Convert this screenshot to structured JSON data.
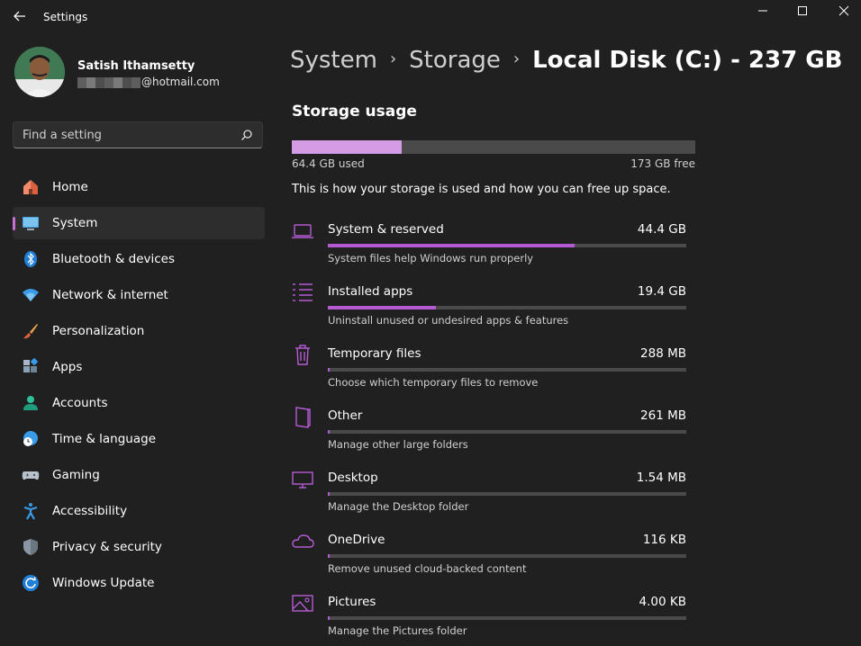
{
  "app": {
    "title": "Settings"
  },
  "user": {
    "name": "Satish Ithamsetty",
    "email_suffix": "@hotmail.com"
  },
  "search": {
    "placeholder": "Find a setting"
  },
  "nav": [
    {
      "label": "Home",
      "icon": "home-icon"
    },
    {
      "label": "System",
      "icon": "system-icon",
      "active": true
    },
    {
      "label": "Bluetooth & devices",
      "icon": "bluetooth-icon"
    },
    {
      "label": "Network & internet",
      "icon": "wifi-icon"
    },
    {
      "label": "Personalization",
      "icon": "brush-icon"
    },
    {
      "label": "Apps",
      "icon": "apps-icon"
    },
    {
      "label": "Accounts",
      "icon": "accounts-icon"
    },
    {
      "label": "Time & language",
      "icon": "globe-clock-icon"
    },
    {
      "label": "Gaming",
      "icon": "gamepad-icon"
    },
    {
      "label": "Accessibility",
      "icon": "accessibility-icon"
    },
    {
      "label": "Privacy & security",
      "icon": "shield-icon"
    },
    {
      "label": "Windows Update",
      "icon": "update-icon"
    }
  ],
  "breadcrumb": {
    "level1": "System",
    "level2": "Storage",
    "current": "Local Disk (C:) - 237 GB"
  },
  "storage": {
    "title": "Storage usage",
    "used_label": "64.4 GB used",
    "free_label": "173 GB free",
    "used_fraction": 0.272,
    "description": "This is how your storage is used and how you can free up space."
  },
  "categories": [
    {
      "name": "System & reserved",
      "size": "44.4 GB",
      "subtitle": "System files help Windows run properly",
      "fraction": 0.689,
      "icon": "laptop-icon"
    },
    {
      "name": "Installed apps",
      "size": "19.4 GB",
      "subtitle": "Uninstall unused or undesired apps & features",
      "fraction": 0.301,
      "icon": "list-icon"
    },
    {
      "name": "Temporary files",
      "size": "288 MB",
      "subtitle": "Choose which temporary files to remove",
      "fraction": 0.005,
      "icon": "trash-icon"
    },
    {
      "name": "Other",
      "size": "261 MB",
      "subtitle": "Manage other large folders",
      "fraction": 0.004,
      "icon": "folder-icon"
    },
    {
      "name": "Desktop",
      "size": "1.54 MB",
      "subtitle": "Manage the Desktop folder",
      "fraction": 0.001,
      "icon": "monitor-icon"
    },
    {
      "name": "OneDrive",
      "size": "116 KB",
      "subtitle": "Remove unused cloud-backed content",
      "fraction": 0.0005,
      "icon": "cloud-icon"
    },
    {
      "name": "Pictures",
      "size": "4.00 KB",
      "subtitle": "Manage the Pictures folder",
      "fraction": 0.0005,
      "icon": "pictures-icon"
    }
  ],
  "colors": {
    "accent": "#c76fd6",
    "usage_fill": "#d49ce4",
    "category_fill": "#b45bd4",
    "background": "#202020"
  }
}
